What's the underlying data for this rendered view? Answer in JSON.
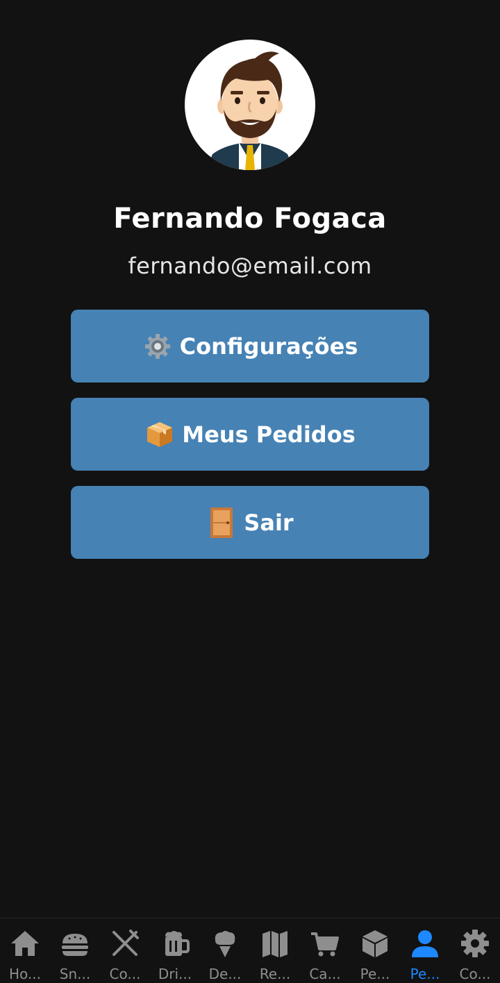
{
  "profile": {
    "name": "Fernando Fogaca",
    "email": "fernando@email.com"
  },
  "menu": {
    "settings_label": "Configurações",
    "orders_label": "Meus Pedidos",
    "logout_label": "Sair"
  },
  "tabs": [
    {
      "label": "Ho...",
      "icon": "home-icon"
    },
    {
      "label": "Sn...",
      "icon": "burger-icon"
    },
    {
      "label": "Co...",
      "icon": "utensils-icon"
    },
    {
      "label": "Dri...",
      "icon": "beer-mug-icon"
    },
    {
      "label": "De...",
      "icon": "ice-cream-icon"
    },
    {
      "label": "Re...",
      "icon": "map-icon"
    },
    {
      "label": "Ca...",
      "icon": "cart-icon"
    },
    {
      "label": "Pe...",
      "icon": "box-icon"
    },
    {
      "label": "Pe...",
      "icon": "person-icon",
      "active": true
    },
    {
      "label": "Co...",
      "icon": "gear-icon"
    }
  ],
  "colors": {
    "background": "#121212",
    "button": "#4682b4",
    "tab_inactive": "#8e8e8e",
    "tab_active": "#1e88ff"
  }
}
